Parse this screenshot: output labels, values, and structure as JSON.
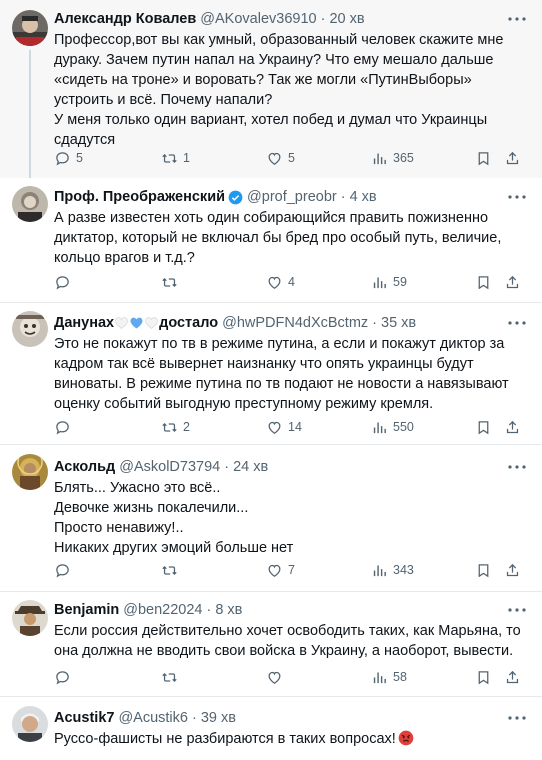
{
  "tweets": [
    {
      "name": "Александр Ковалев",
      "handle": "@AKovalev36910",
      "time": "20 хв",
      "text": "Профессор,вот вы как умный, образованный человек скажите мне дураку. Зачем путин напал на Украину? Что ему мешало дальше «сидеть на троне» и воровать? Так же могли «ПутинВыборы» устроить и всё. Почему напали?\nУ меня только один вариант, хотел побед и думал что Украинцы сдадутся",
      "replies": "5",
      "reposts": "1",
      "likes": "5",
      "views": "365"
    },
    {
      "name": "Проф. Преображенский",
      "handle": "@prof_preobr",
      "time": "4 хв",
      "text": "А разве известен хоть один собирающийся править пожизненно диктатор, который не включал бы бред про особый путь, величие, кольцо врагов и т.д.?",
      "replies": "",
      "reposts": "",
      "likes": "4",
      "views": "59"
    },
    {
      "name_a": "Данунах",
      "name_b": "достало",
      "handle": "@hwPDFN4dXcBctmz",
      "time": "35 хв",
      "text": "Это не покажут по тв в режиме путина, а если и покажут диктор за кадром так всё вывернет наизнанку что опять украинцы будут виноваты. В режиме путина по тв подают не новости а навязывают оценку событий выгодную преступному режиму кремля.",
      "replies": "",
      "reposts": "2",
      "likes": "14",
      "views": "550"
    },
    {
      "name": "Аскольд",
      "handle": "@AskolD73794",
      "time": "24 хв",
      "text": "Блять... Ужасно это всё..\nДевочке жизнь покалечили...\nПросто ненавижу!..\nНикаких других эмоций больше нет",
      "replies": "",
      "reposts": "",
      "likes": "7",
      "views": "343"
    },
    {
      "name": "Benjamin",
      "handle": "@ben22024",
      "time": "8 хв",
      "text": "Если россия действительно хочет освободить таких, как Марьяна, то она должна не вводить свои войска в Украину, а наоборот, вывести.",
      "replies": "",
      "reposts": "",
      "likes": "",
      "views": "58"
    },
    {
      "name": "Acustik7",
      "handle": "@Acustik6",
      "time": "39 хв",
      "text": "Руссо-фашисты не разбираются в таких вопросах!"
    }
  ],
  "icons": {
    "reply": "reply-icon",
    "repost": "repost-icon",
    "like": "heart-icon",
    "views": "views-icon",
    "bookmark": "bookmark-icon",
    "share": "share-icon",
    "more": "more-icon",
    "verified": "verified-badge-icon"
  },
  "colors": {
    "text": "#0f1419",
    "secondary": "#536471",
    "verified": "#1d9bf0",
    "highlight_bg": "#f7f7f8",
    "divider": "#e6e9eb"
  }
}
